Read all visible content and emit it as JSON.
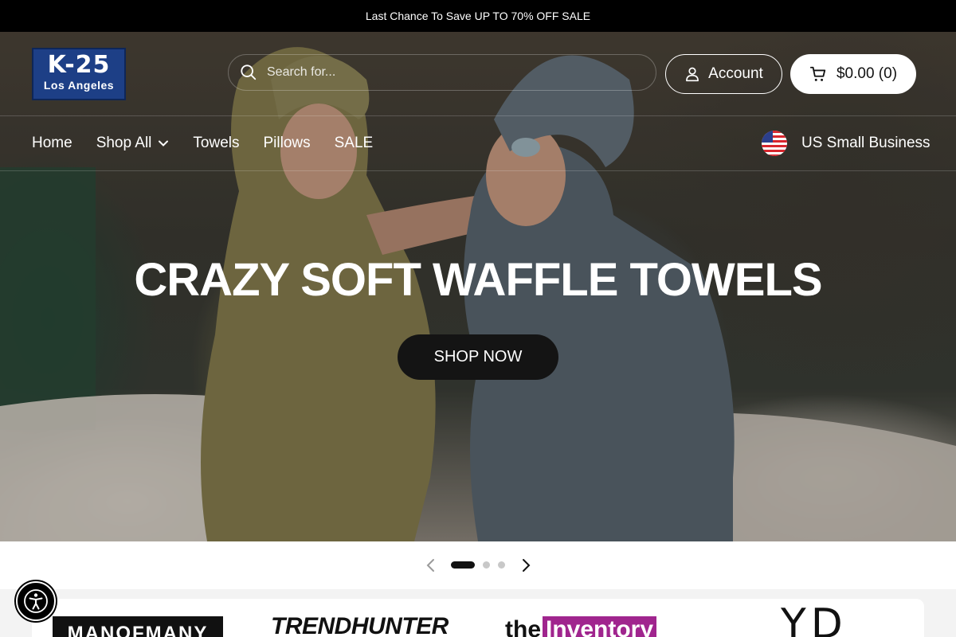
{
  "announcement": {
    "text": "Last Chance To Save UP TO 70% OFF SALE"
  },
  "header": {
    "logo": {
      "main": "K-25",
      "sub": "Los Angeles"
    },
    "search": {
      "placeholder": "Search for..."
    },
    "account_label": "Account",
    "cart_label": "$0.00 (0)"
  },
  "nav": {
    "items": [
      {
        "label": "Home"
      },
      {
        "label": "Shop All",
        "has_dropdown": true
      },
      {
        "label": "Towels"
      },
      {
        "label": "Pillows"
      },
      {
        "label": "SALE"
      }
    ],
    "badge": {
      "label": "US Small Business",
      "icon": "us-flag-icon"
    }
  },
  "hero": {
    "title": "CRAZY SOFT WAFFLE TOWELS",
    "cta_label": "SHOP NOW",
    "slide_count": 3,
    "active_slide": 1
  },
  "press": {
    "logos": [
      {
        "name": "MANOFMANY"
      },
      {
        "name": "TRENDHUNTER"
      },
      {
        "name_a": "the",
        "name_b": "Inventory"
      },
      {
        "name": "YD"
      }
    ]
  },
  "colors": {
    "announcement_bg": "#000000",
    "logo_bg": "#1d3f86",
    "cta_bg": "#141414",
    "inventory_accent": "#a0258e"
  }
}
